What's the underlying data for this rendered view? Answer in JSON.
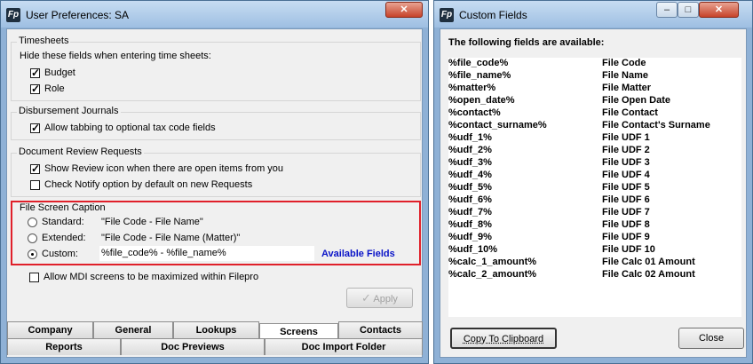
{
  "prefs": {
    "title": "User Preferences: SA",
    "timesheets": {
      "label": "Timesheets",
      "hide_label": "Hide these fields when entering time sheets:",
      "budget": "Budget",
      "role": "Role"
    },
    "disbursement": {
      "label": "Disbursement Journals",
      "allow_tabbing": "Allow tabbing to optional tax code fields"
    },
    "doc_review": {
      "label": "Document Review Requests",
      "show_icon": "Show Review icon when there are open items from you",
      "check_notify": "Check Notify option by default on new Requests"
    },
    "caption": {
      "label": "File Screen Caption",
      "standard_label": "Standard:",
      "standard_value": "\"File Code - File Name\"",
      "extended_label": "Extended:",
      "extended_value": "\"File Code - File Name (Matter)\"",
      "custom_label": "Custom:",
      "custom_value": "%file_code% - %file_name%",
      "available_fields_link": "Available Fields"
    },
    "mdi_label": "Allow MDI screens to be maximized within Filepro",
    "apply_label": "Apply",
    "tabs_row1": [
      "Company",
      "General",
      "Lookups",
      "Screens",
      "Contacts"
    ],
    "tabs_row2": [
      "Reports",
      "Doc Previews",
      "Doc Import Folder"
    ]
  },
  "custom_fields": {
    "title": "Custom Fields",
    "intro": "The following fields are available:",
    "fields": [
      {
        "code": "%file_code%",
        "desc": "File Code"
      },
      {
        "code": "%file_name%",
        "desc": "File Name"
      },
      {
        "code": "%matter%",
        "desc": "File Matter"
      },
      {
        "code": "%open_date%",
        "desc": "File Open Date"
      },
      {
        "code": "%contact%",
        "desc": "File Contact"
      },
      {
        "code": "%contact_surname%",
        "desc": "File Contact's Surname"
      },
      {
        "code": "%udf_1%",
        "desc": "File UDF 1"
      },
      {
        "code": "%udf_2%",
        "desc": "File UDF 2"
      },
      {
        "code": "%udf_3%",
        "desc": "File UDF 3"
      },
      {
        "code": "%udf_4%",
        "desc": "File UDF 4"
      },
      {
        "code": "%udf_5%",
        "desc": "File UDF 5"
      },
      {
        "code": "%udf_6%",
        "desc": "File UDF 6"
      },
      {
        "code": "%udf_7%",
        "desc": "File UDF 7"
      },
      {
        "code": "%udf_8%",
        "desc": "File UDF 8"
      },
      {
        "code": "%udf_9%",
        "desc": "File UDF 9"
      },
      {
        "code": "%udf_10%",
        "desc": "File UDF 10"
      },
      {
        "code": "%calc_1_amount%",
        "desc": "File Calc 01 Amount"
      },
      {
        "code": "%calc_2_amount%",
        "desc": "File Calc 02 Amount"
      }
    ],
    "copy_label": "Copy To Clipboard",
    "close_label": "Close"
  },
  "window_controls": {
    "minimize": "–",
    "maximize": "□",
    "close": "✕"
  },
  "colors": {
    "highlight_border": "#e0202a",
    "link": "#0a14c8",
    "app_icon": "#1f2f3f"
  },
  "icons": [
    "filepro-app-icon",
    "check-icon",
    "close-icon",
    "minimize-icon",
    "maximize-icon"
  ]
}
